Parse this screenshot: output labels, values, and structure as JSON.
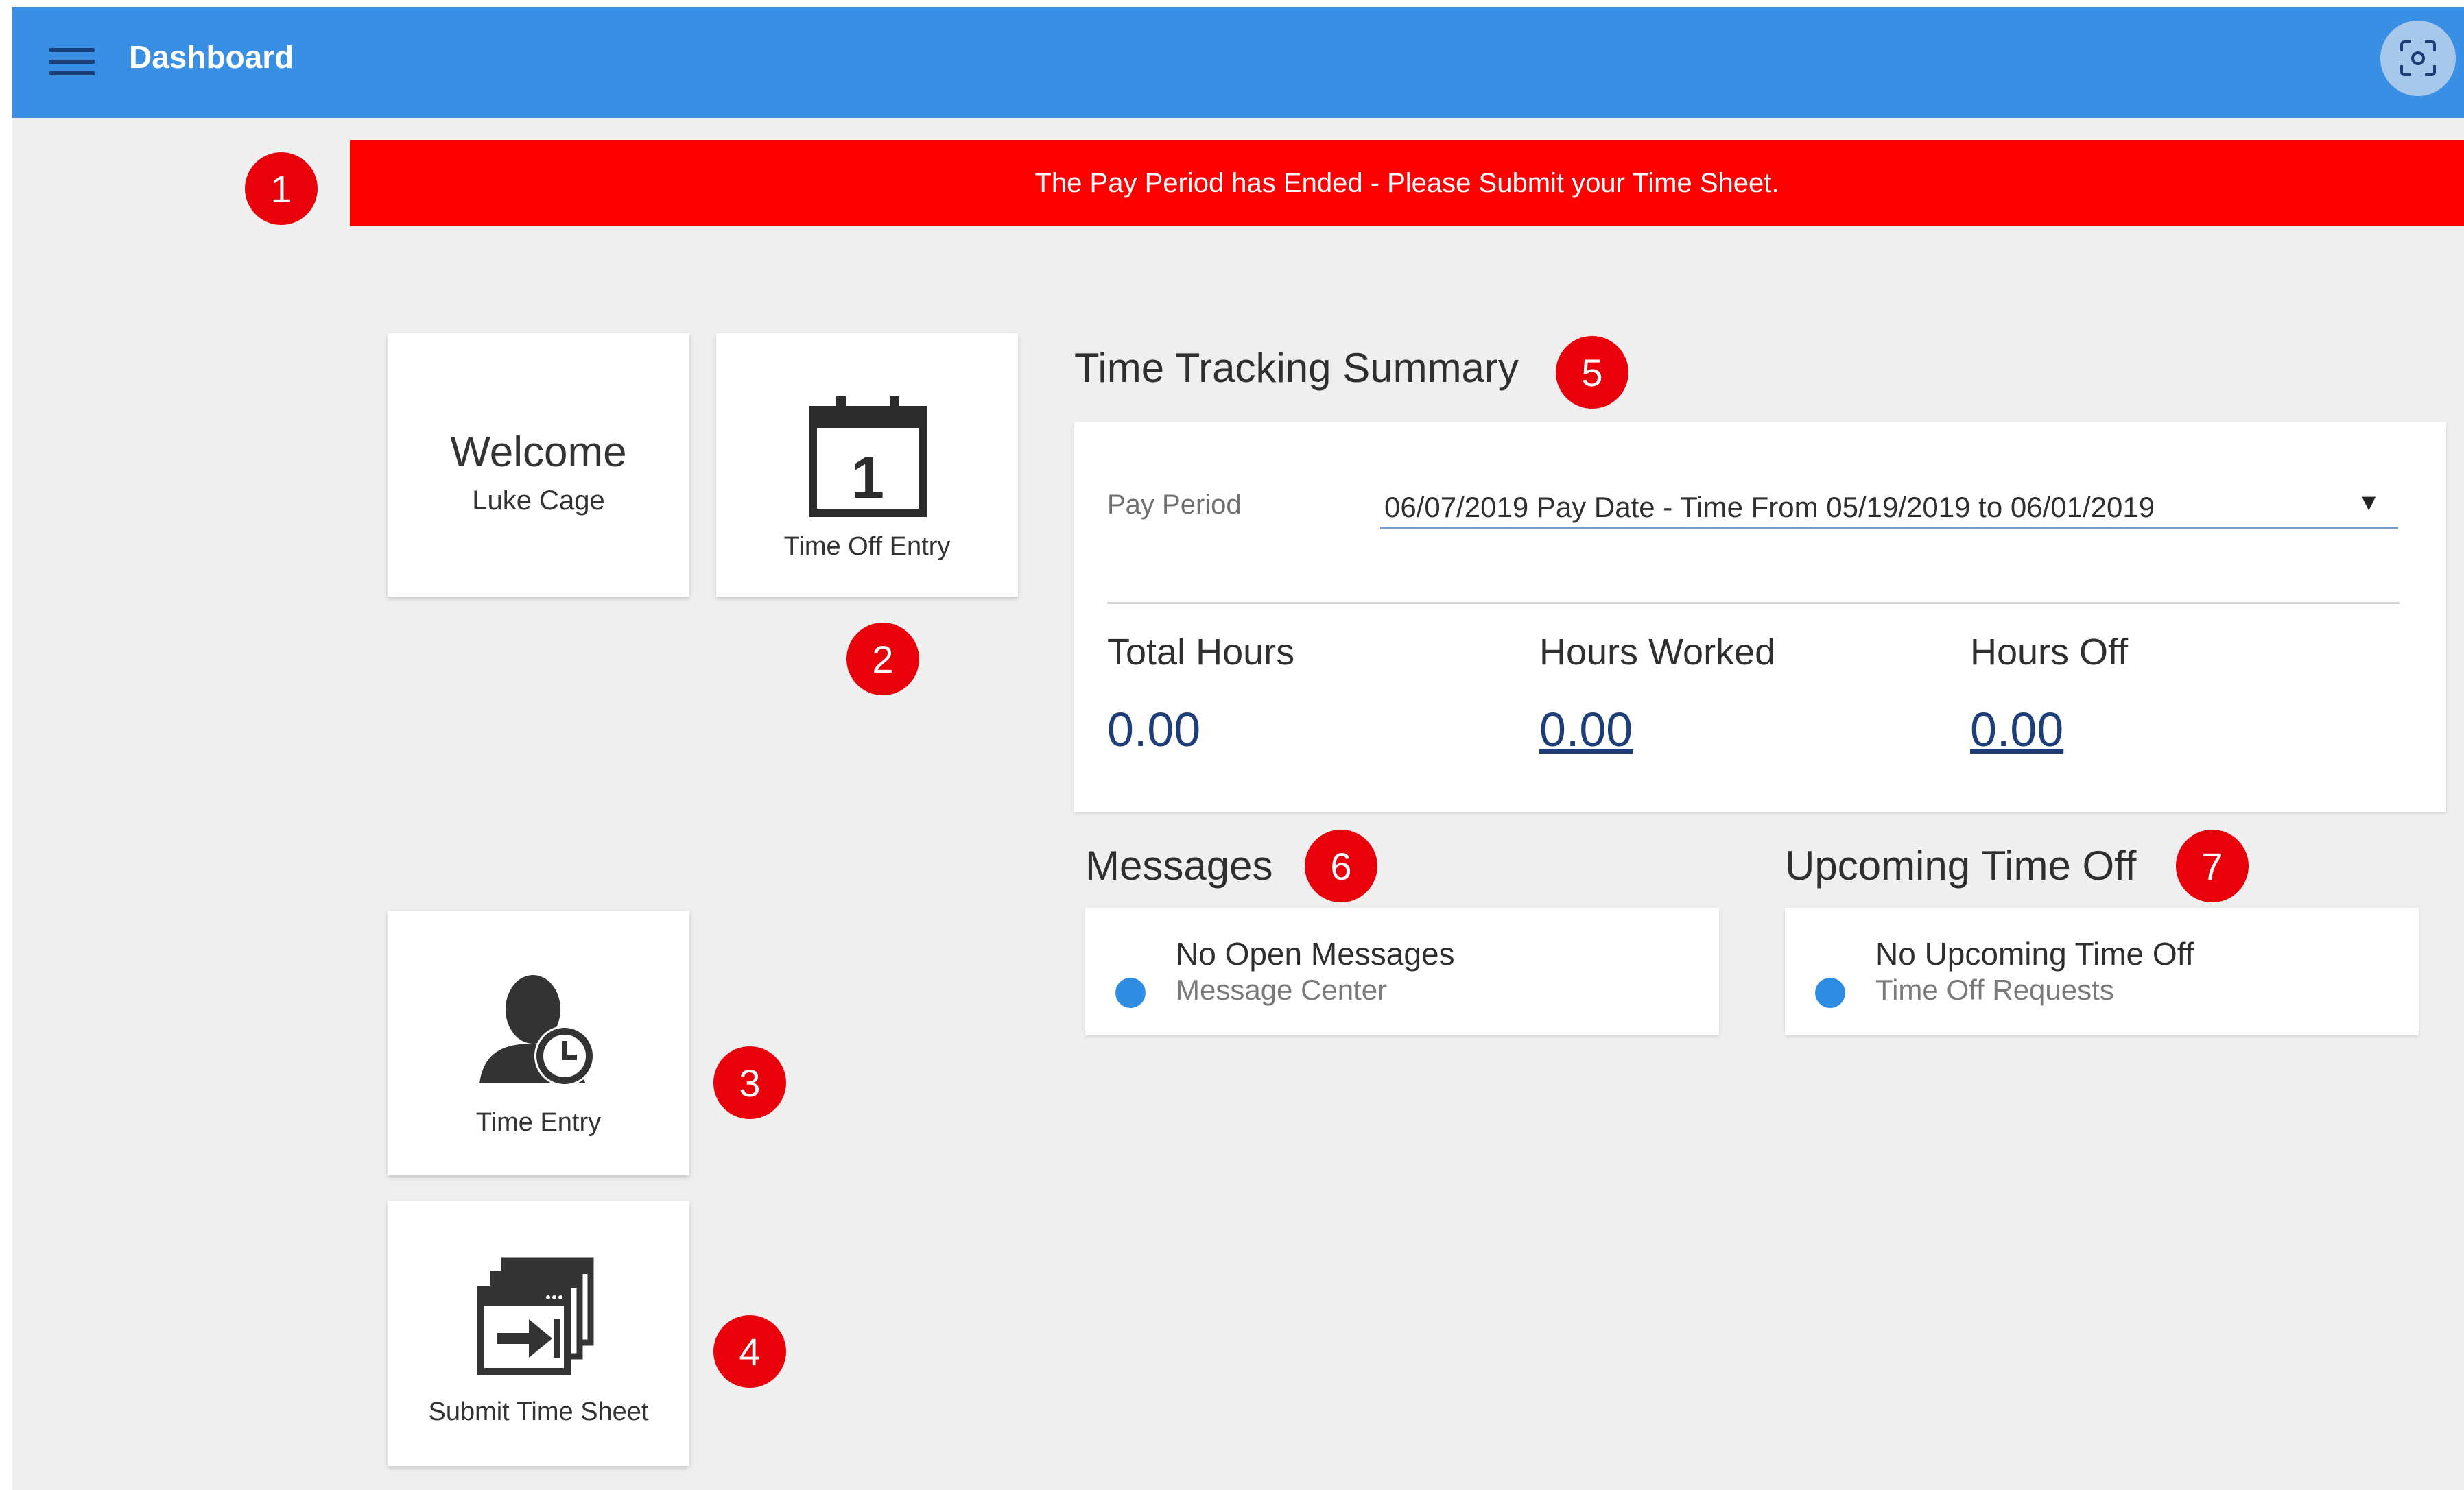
{
  "header": {
    "title": "Dashboard",
    "menu_icon": "hamburger-menu-icon",
    "scan_icon": "focus-scan-icon",
    "bar_color": "#388fe3"
  },
  "alert": {
    "text": "The Pay Period has Ended - Please Submit your Time Sheet.",
    "color": "#ff0000"
  },
  "callouts": [
    "1",
    "2",
    "3",
    "4",
    "5",
    "6",
    "7"
  ],
  "tiles": {
    "welcome": {
      "heading": "Welcome",
      "name": "Luke Cage"
    },
    "time_off_entry": {
      "label": "Time Off Entry",
      "icon": "calendar-icon",
      "icon_text": "1"
    },
    "time_entry": {
      "label": "Time Entry",
      "icon": "user-clock-icon"
    },
    "submit_time_sheet": {
      "label": "Submit Time Sheet",
      "icon": "submit-windows-icon"
    }
  },
  "summary": {
    "title": "Time Tracking Summary",
    "pay_period_label": "Pay Period",
    "pay_period_value": "06/07/2019 Pay Date - Time From 05/19/2019 to 06/01/2019",
    "total_hours_label": "Total Hours",
    "total_hours_value": "0.00",
    "hours_worked_label": "Hours Worked",
    "hours_worked_value": "0.00",
    "hours_off_label": "Hours Off",
    "hours_off_value": "0.00"
  },
  "messages": {
    "title": "Messages",
    "item_title": "No Open Messages",
    "item_sub": "Message Center"
  },
  "upcoming": {
    "title": "Upcoming Time Off",
    "item_title": "No Upcoming Time Off",
    "item_sub": "Time Off Requests"
  },
  "colors": {
    "accent": "#2e8ce3",
    "callout": "#e8000b",
    "link": "#1d3e78"
  }
}
